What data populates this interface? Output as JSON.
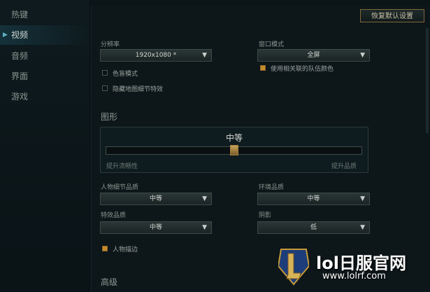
{
  "sidebar": {
    "items": [
      {
        "label": "热键"
      },
      {
        "label": "视频"
      },
      {
        "label": "音频"
      },
      {
        "label": "界面"
      },
      {
        "label": "游戏"
      }
    ]
  },
  "toolbar": {
    "reset_label": "恢复默认设置"
  },
  "video": {
    "resolution_label": "分辨率",
    "resolution_value": "1920x1080 *",
    "window_mode_label": "窗口模式",
    "window_mode_value": "全屏",
    "colorblind_label": "色盲模式",
    "colorblind_checked": false,
    "hide_eyecandy_label": "隐藏地图细节特效",
    "hide_eyecandy_checked": false,
    "team_colors_label": "使用相关联的队伍颜色",
    "team_colors_checked": true
  },
  "graphics": {
    "section_title": "图形",
    "quality_label": "中等",
    "quality_level_fraction": 0.5,
    "hint_left": "提升流畅性",
    "hint_right": "提升品质",
    "character_quality_label": "人物细节品质",
    "character_quality_value": "中等",
    "environment_quality_label": "环境品质",
    "environment_quality_value": "中等",
    "effects_quality_label": "特效品质",
    "effects_quality_value": "中等",
    "shadows_label": "阴影",
    "shadows_value": "低",
    "character_inking_label": "人物描边",
    "character_inking_checked": true
  },
  "advanced": {
    "section_title": "高级"
  },
  "watermark": {
    "title": "lol日服官网",
    "url": "www.lolrf.com"
  },
  "colors": {
    "accent": "#c58a2a",
    "border_gold": "#7d6a3c",
    "teal": "#5fb4c4"
  }
}
